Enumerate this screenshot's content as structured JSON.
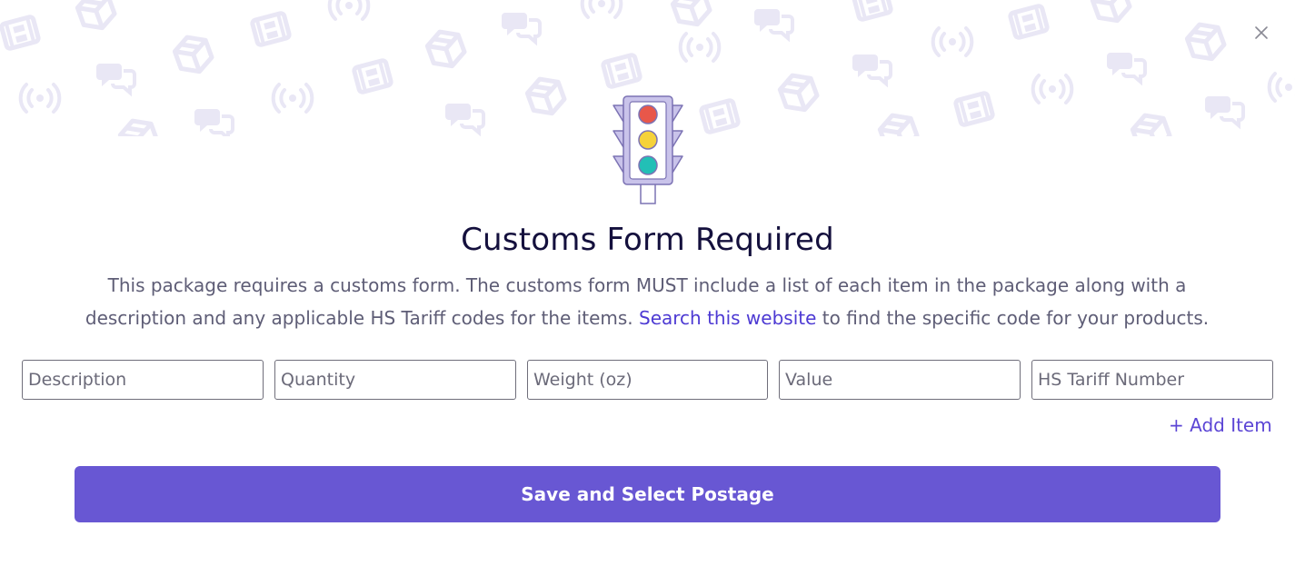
{
  "modal": {
    "close_icon": "close-icon",
    "hero_icon": "traffic-light-icon",
    "background_pattern_icons": [
      "package-icon",
      "film-icon",
      "broadcast-icon",
      "chat-icon"
    ],
    "title": "Customs Form Required",
    "description": {
      "before_link": "This package requires a customs form. The customs form MUST include a list of each item in the package along with a description and any applicable HS Tariff codes for the items. ",
      "link_text": "Search this website",
      "after_link": " to find the specific code for your products."
    },
    "fields": {
      "description": {
        "placeholder": "Description",
        "value": ""
      },
      "quantity": {
        "placeholder": "Quantity",
        "value": ""
      },
      "weight": {
        "placeholder": "Weight (oz)",
        "value": ""
      },
      "value": {
        "placeholder": "Value",
        "value": ""
      },
      "hs_tariff": {
        "placeholder": "HS Tariff Number",
        "value": ""
      }
    },
    "add_item_label": "+ Add Item",
    "submit_label": "Save and Select Postage"
  },
  "colors": {
    "accent": "#6857d3",
    "link": "#4d3ad3",
    "title": "#14103d",
    "body_text": "#5e5d76",
    "pattern": "#e9e7f5",
    "traffic_light_body": "#c9c3ea",
    "traffic_light_red": "#e8574a",
    "traffic_light_yellow": "#f5d23a",
    "traffic_light_green": "#22bfb6"
  }
}
